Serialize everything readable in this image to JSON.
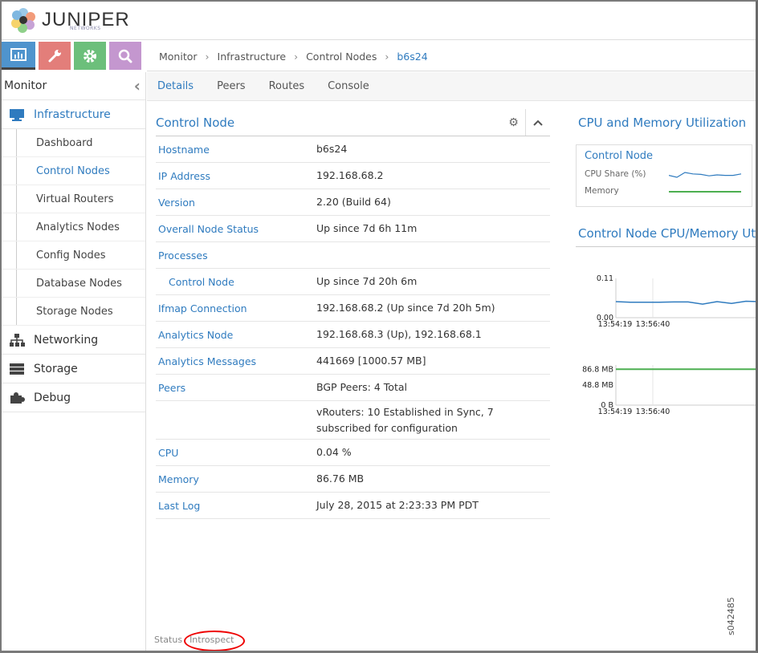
{
  "brand": {
    "name": "JUNIPER",
    "sub": "NETWORKS"
  },
  "toolbar": [
    {
      "name": "monitor"
    },
    {
      "name": "configure"
    },
    {
      "name": "settings"
    },
    {
      "name": "query"
    }
  ],
  "sidebar": {
    "title": "Monitor",
    "categories": [
      {
        "label": "Infrastructure"
      },
      {
        "label": "Networking"
      },
      {
        "label": "Storage"
      },
      {
        "label": "Debug"
      }
    ],
    "items": [
      {
        "label": "Dashboard"
      },
      {
        "label": "Control Nodes"
      },
      {
        "label": "Virtual Routers"
      },
      {
        "label": "Analytics Nodes"
      },
      {
        "label": "Config Nodes"
      },
      {
        "label": "Database Nodes"
      },
      {
        "label": "Storage Nodes"
      }
    ]
  },
  "breadcrumb": [
    "Monitor",
    "Infrastructure",
    "Control Nodes",
    "b6s24"
  ],
  "tabs": [
    "Details",
    "Peers",
    "Routes",
    "Console"
  ],
  "control_node": {
    "title": "Control Node",
    "rows": [
      {
        "k": "Hostname",
        "v": "b6s24"
      },
      {
        "k": "IP Address",
        "v": "192.168.68.2"
      },
      {
        "k": "Version",
        "v": "2.20 (Build 64)"
      },
      {
        "k": "Overall Node Status",
        "v": "Up since 7d 6h 11m"
      },
      {
        "k": "Processes",
        "v": ""
      },
      {
        "k": "Control Node",
        "v": "Up since 7d 20h 6m"
      },
      {
        "k": "Ifmap Connection",
        "v": "192.168.68.2 (Up since 7d 20h 5m)"
      },
      {
        "k": "Analytics Node",
        "v": "192.168.68.3 (Up), 192.168.68.1"
      },
      {
        "k": "Analytics Messages",
        "v": "441669 [1000.57 MB]"
      },
      {
        "k": "Peers",
        "v": "BGP Peers: 4 Total"
      },
      {
        "k": "",
        "v": "vRouters: 10 Established in Sync, 7 subscribed for configuration"
      },
      {
        "k": "CPU",
        "v": "0.04 %"
      },
      {
        "k": "Memory",
        "v": "86.76 MB"
      },
      {
        "k": "Last Log",
        "v": "July 28, 2015 at 2:23:33 PM PDT"
      }
    ]
  },
  "utilization": {
    "title": "CPU and Memory Utilization",
    "spark_title": "Control Node",
    "cpu_label": "CPU Share (%)",
    "mem_label": "Memory"
  },
  "chart_title": "Control Node CPU/Memory Utilization",
  "chart_data": [
    {
      "type": "line",
      "title": "CPU",
      "ylim": [
        0,
        0.11
      ],
      "yticks": [
        "0.11",
        "0.00"
      ],
      "xticks": [
        "13:54:19",
        "13:56:40"
      ],
      "series": [
        {
          "name": "CPU Share (%)",
          "color": "#2f7bbf",
          "values": [
            0.045,
            0.043,
            0.043,
            0.043,
            0.044,
            0.044,
            0.038,
            0.045,
            0.04,
            0.046,
            0.045
          ]
        }
      ]
    },
    {
      "type": "line",
      "title": "Memory",
      "ylim": [
        0,
        97
      ],
      "yticks": [
        "86.8 MB",
        "48.8 MB",
        "0 B"
      ],
      "ytick_values": [
        86.8,
        48.8,
        0
      ],
      "xticks": [
        "13:54:19",
        "13:56:40"
      ],
      "series": [
        {
          "name": "Memory",
          "color": "#4caf50",
          "values": [
            86.8,
            86.8
          ]
        }
      ]
    }
  ],
  "sparkline_cpu": [
    0.044,
    0.04,
    0.05,
    0.047,
    0.046,
    0.043,
    0.045,
    0.044,
    0.044,
    0.047
  ],
  "footer": {
    "status": "Status",
    "introspect": "Introspect"
  },
  "figure_id": "s042485",
  "colors": {
    "accent": "#2f7bbf",
    "monitor": "#4f94cd",
    "configure": "#e37e7a",
    "settings": "#6cbf7b",
    "query": "#c497cf"
  }
}
